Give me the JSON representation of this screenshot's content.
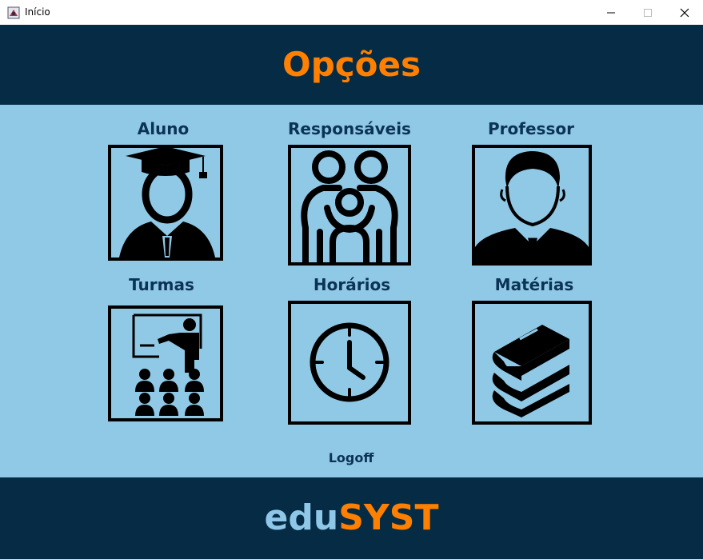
{
  "window": {
    "title": "Início"
  },
  "header": {
    "title": "Opções"
  },
  "options": [
    {
      "label": "Aluno",
      "icon": "student-graduate-icon"
    },
    {
      "label": "Responsáveis",
      "icon": "family-icon"
    },
    {
      "label": "Professor",
      "icon": "teacher-person-icon"
    },
    {
      "label": "Turmas",
      "icon": "classroom-icon"
    },
    {
      "label": "Horários",
      "icon": "clock-icon"
    },
    {
      "label": "Matérias",
      "icon": "books-icon"
    }
  ],
  "logoff_label": "Logoff",
  "footer": {
    "brand_part1": "edu",
    "brand_part2": "SYST"
  },
  "colors": {
    "header_bg": "#062b45",
    "body_bg": "#90c9e6",
    "accent": "#ff8000",
    "label": "#0b3354",
    "brand_light": "#8fc7e8"
  }
}
